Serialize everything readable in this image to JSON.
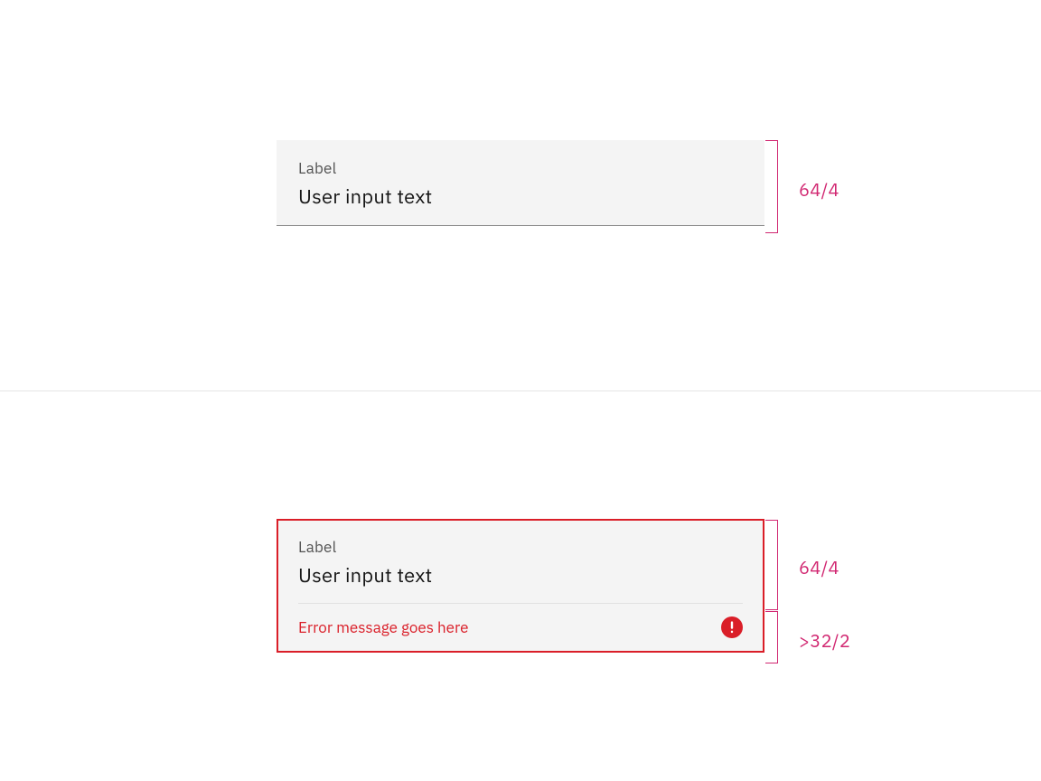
{
  "example1": {
    "label": "Label",
    "value": "User input text",
    "height_spec": "64/4"
  },
  "example2": {
    "label": "Label",
    "value": "User input text",
    "error_message": "Error message goes here",
    "field_height_spec": "64/4",
    "error_height_spec": ">32/2"
  },
  "colors": {
    "spec_pink": "#d12771",
    "error_red": "#da1e28",
    "field_bg": "#f4f4f4"
  }
}
